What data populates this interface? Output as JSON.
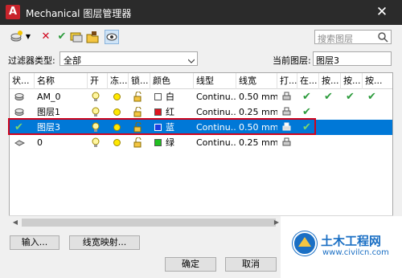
{
  "window": {
    "title": "Mechanical 图层管理器",
    "app_icon_letter": "A",
    "close_glyph": "✕"
  },
  "toolbar": {
    "icons": [
      "new-layer-icon",
      "dropdown-icon",
      "delete-icon",
      "set-current-icon",
      "layer-states-icon",
      "folder-icon",
      "eye-icon"
    ]
  },
  "search": {
    "placeholder": "搜索图层"
  },
  "filter": {
    "label": "过滤器类型:",
    "value": "全部"
  },
  "current_layer": {
    "label": "当前图层:",
    "value": "图层3"
  },
  "columns": [
    "状...",
    "名称",
    "开",
    "冻...",
    "锁...",
    "颜色",
    "线型",
    "线宽",
    "打...",
    "在...",
    "按...",
    "按...",
    "按..."
  ],
  "rows": [
    {
      "name": "AM_0",
      "color_name": "白",
      "color_hex": "#ffffff",
      "linetype": "Continu...",
      "lineweight": "0.50 mm",
      "checks": [
        true,
        true,
        true,
        true
      ],
      "status": "layer-stack-icon",
      "selected": false
    },
    {
      "name": "图层1",
      "color_name": "红",
      "color_hex": "#e0141e",
      "linetype": "Continu...",
      "lineweight": "0.25 mm",
      "checks": [
        true,
        false,
        false,
        false
      ],
      "status": "layer-stack-icon",
      "selected": false
    },
    {
      "name": "图层3",
      "color_name": "蓝",
      "color_hex": "#1d3ee0",
      "linetype": "Continu...",
      "lineweight": "0.50 mm",
      "checks": [
        true,
        false,
        false,
        false
      ],
      "status": "current-check-icon",
      "selected": true
    },
    {
      "name": "0",
      "color_name": "绿",
      "color_hex": "#20c020",
      "linetype": "Continu...",
      "lineweight": "0.25 mm",
      "checks": [
        false,
        false,
        false,
        false
      ],
      "status": "layer-arrow-icon",
      "selected": false
    }
  ],
  "buttons": {
    "input": "输入...",
    "linewidth_map": "线宽映射...",
    "ok": "确定",
    "cancel": "取消"
  },
  "watermark": {
    "name": "土木工程网",
    "url": "www.civilcn.com"
  },
  "colors": {
    "title_bar": "#2b2b2b",
    "selection": "#0078d7",
    "highlight_outline": "#d0021b"
  }
}
